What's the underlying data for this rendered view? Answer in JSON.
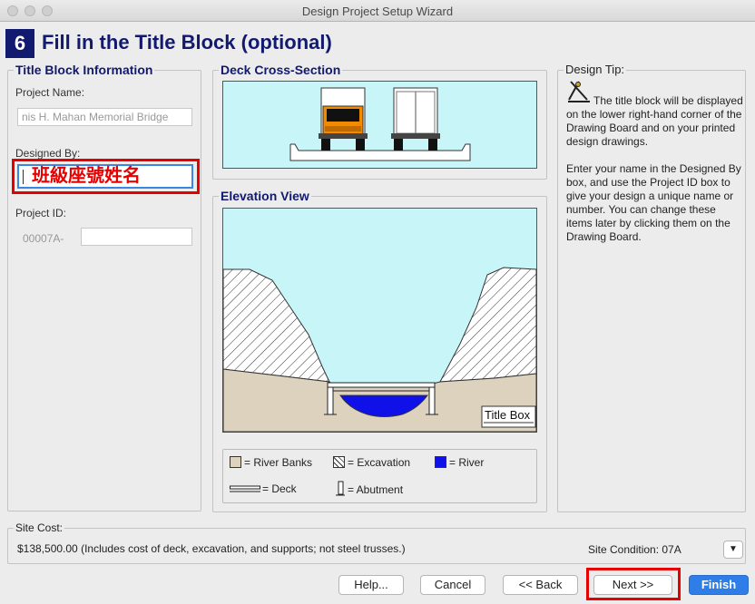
{
  "window": {
    "title": "Design Project Setup Wizard"
  },
  "step": {
    "number": "6",
    "title": "Fill in the Title Block (optional)"
  },
  "title_block": {
    "legend": "Title Block Information",
    "project_name_label": "Project Name:",
    "project_name_value": "nis H. Mahan Memorial Bridge",
    "designed_by_label": "Designed By:",
    "designed_by_value": "班級座號姓名",
    "project_id_label": "Project ID:",
    "project_id_prefix": "00007A-",
    "project_id_value": ""
  },
  "deck": {
    "legend": "Deck Cross-Section"
  },
  "elevation": {
    "legend": "Elevation View",
    "title_box": "Title Box"
  },
  "legend_items": {
    "river_banks": "= River Banks",
    "excavation": "= Excavation",
    "river": "= River",
    "deck": "= Deck",
    "abutment": "= Abutment"
  },
  "tip": {
    "legend": "Design Tip:",
    "paragraph1": "The title block will be displayed on the lower right-hand corner of the Drawing Board and on your printed design drawings.",
    "paragraph2": "Enter your name in the Designed By box, and use the Project ID box to give your design a unique name or number. You can change these items later by clicking them on the Drawing Board."
  },
  "site": {
    "legend": "Site Cost:",
    "cost_text": "$138,500.00 (Includes cost of deck, excavation, and supports; not steel trusses.)",
    "condition_text": "Site Condition: 07A"
  },
  "buttons": {
    "help": "Help...",
    "cancel": "Cancel",
    "back": "<< Back",
    "next": "Next >>",
    "finish": "Finish"
  },
  "colors": {
    "accent": "#111a6e",
    "highlight": "#e60000",
    "sky": "#c8f5f8",
    "bank": "#ddd2be",
    "river": "#1010e8",
    "primary": "#2f7ee8"
  }
}
